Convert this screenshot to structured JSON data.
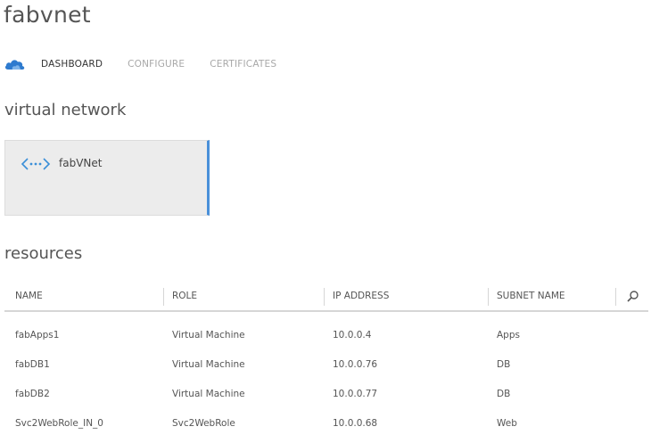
{
  "header": {
    "title": "fabvnet"
  },
  "tabs": [
    {
      "label": "DASHBOARD",
      "active": true
    },
    {
      "label": "CONFIGURE",
      "active": false
    },
    {
      "label": "CERTIFICATES",
      "active": false
    }
  ],
  "virtual_network": {
    "section_title": "virtual network",
    "tile_label": "fabVNet"
  },
  "resources": {
    "section_title": "resources",
    "columns": [
      "NAME",
      "ROLE",
      "IP ADDRESS",
      "SUBNET NAME"
    ],
    "rows": [
      {
        "name": "fabApps1",
        "role": "Virtual Machine",
        "ip": "10.0.0.4",
        "subnet": "Apps"
      },
      {
        "name": "fabDB1",
        "role": "Virtual Machine",
        "ip": "10.0.0.76",
        "subnet": "DB"
      },
      {
        "name": "fabDB2",
        "role": "Virtual Machine",
        "ip": "10.0.0.77",
        "subnet": "DB"
      },
      {
        "name": "Svc2WebRole_IN_0",
        "role": "Svc2WebRole",
        "ip": "10.0.0.68",
        "subnet": "Web"
      }
    ]
  },
  "icons": {
    "dashboard": "cloud-icon",
    "vnet": "network-icon",
    "search": "search-icon"
  },
  "colors": {
    "accent": "#4a90d9",
    "tile_bg": "#ececec"
  }
}
